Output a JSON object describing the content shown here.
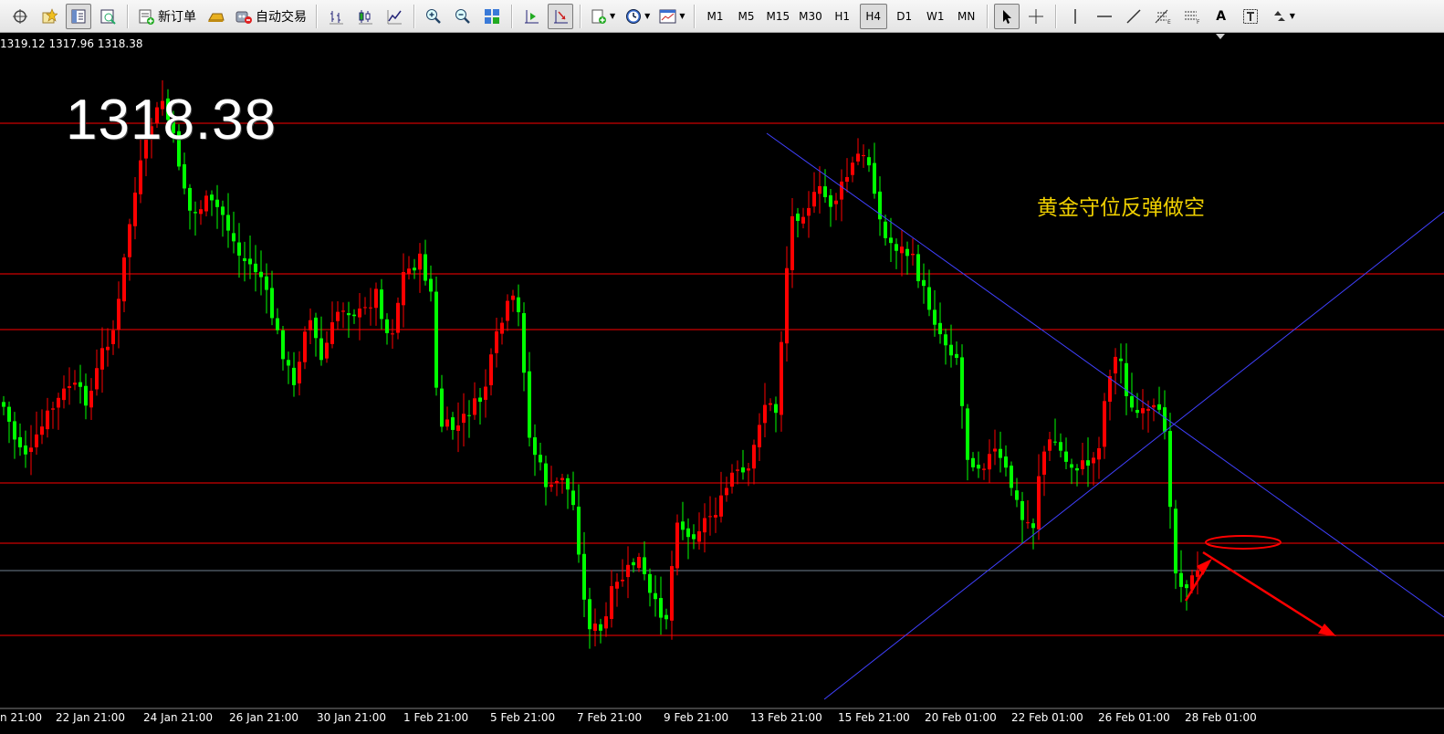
{
  "toolbar": {
    "new_order_label": "新订单",
    "auto_trading_label": "自动交易",
    "timeframes": [
      "M1",
      "M5",
      "M15",
      "M30",
      "H1",
      "H4",
      "D1",
      "W1",
      "MN"
    ],
    "active_timeframe": "H4",
    "text_tool": "A",
    "icons": [
      "crosshair-icon",
      "favorites-icon",
      "navigator-icon",
      "strategy-tester-icon",
      "new-order-icon",
      "gold-bar-icon",
      "auto-trading-icon",
      "bar-chart-icon",
      "candlestick-icon",
      "line-chart-icon",
      "zoom-in-icon",
      "zoom-out-icon",
      "tile-windows-icon",
      "chart-shift-icon",
      "autoscroll-icon",
      "add-indicator-icon",
      "periods-clock-icon",
      "templates-icon",
      "cursor-icon",
      "crosshair-tool-icon",
      "vertical-line-icon",
      "horizontal-line-icon",
      "trendline-icon",
      "fibonacci-icon",
      "fibo-expansion-icon",
      "text-label-icon",
      "arrows-icon"
    ]
  },
  "chart": {
    "ohlc_text": "1319.12 1317.96 1318.38",
    "bid_price": "1318.38",
    "annotation": "黄金守位反弹做空",
    "x_labels": [
      "n 21:00",
      "22 Jan 21:00",
      "24 Jan 21:00",
      "26 Jan 21:00",
      "30 Jan 21:00",
      "1 Feb 21:00",
      "5 Feb 21:00",
      "7 Feb 21:00",
      "9 Feb 21:00",
      "13 Feb 21:00",
      "15 Feb 21:00",
      "20 Feb 01:00",
      "22 Feb 01:00",
      "26 Feb 01:00",
      "28 Feb 01:00"
    ],
    "colors": {
      "background": "#000000",
      "bull": "#ff0000",
      "bear": "#00ff00",
      "level_line": "#ff0000",
      "bid_line": "#708090",
      "trendline": "#4040ff",
      "annotation_text": "#f0d000"
    }
  }
}
